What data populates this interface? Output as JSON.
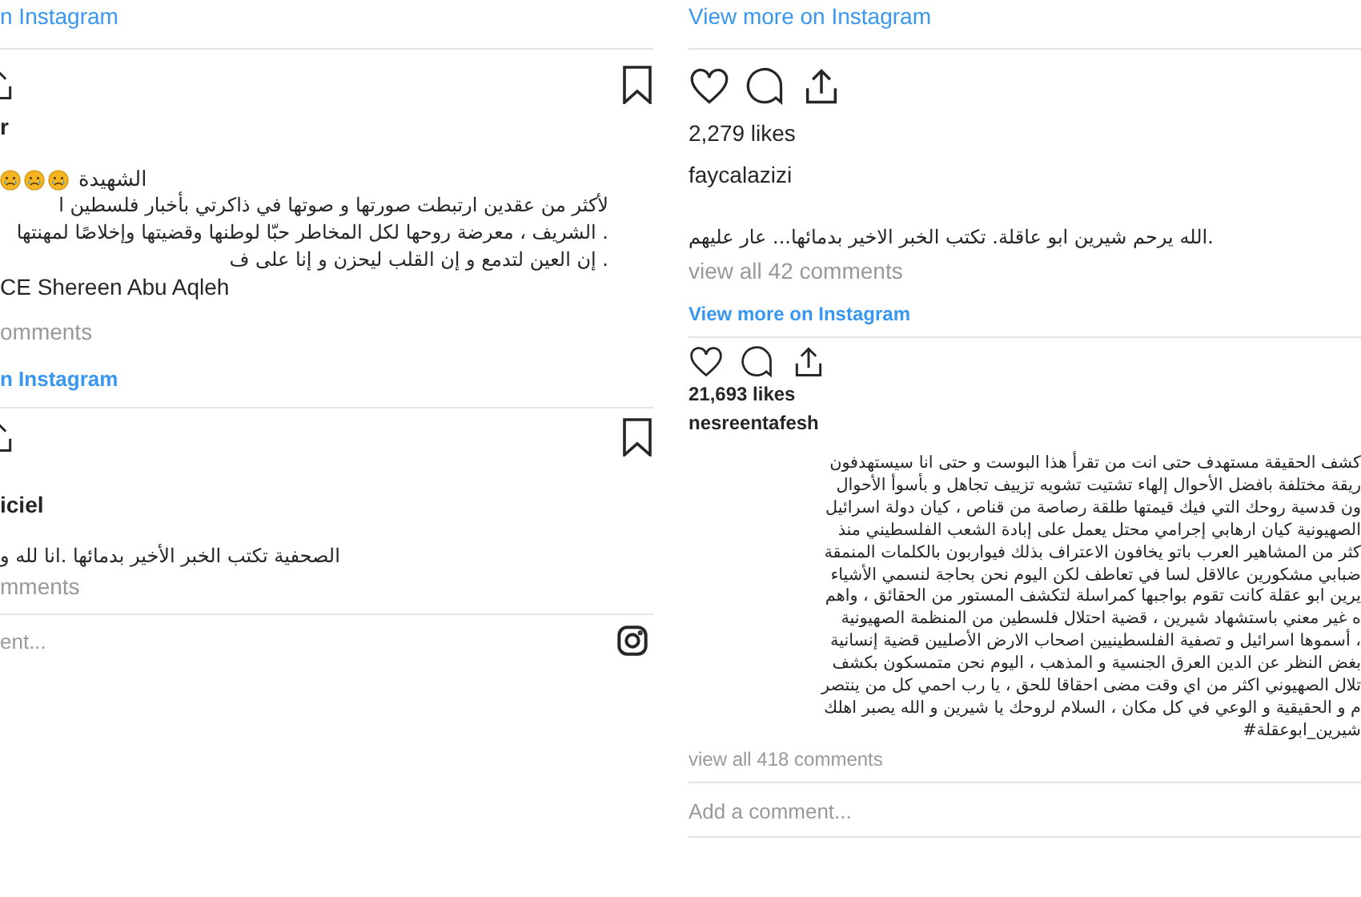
{
  "left_post_1": {
    "view_more_link": "n Instagram",
    "username": "r",
    "caption_title": "الشهيدة",
    "caption_lines": [
      "لأكثر من عقدين ارتبطت صورتها و صوتها في ذاكرتي بأخبار فلسطين ا",
      ". الشريف ، معرضة روحها لكل المخاطر حبّا لوطنها وقضيتها وإخلاصًا لمهنتها",
      ". إن العين لتدمع و إن القلب ليحزن و إنا على ف"
    ],
    "caption_end": "CE Shereen Abu Aqleh",
    "comments_link": "omments",
    "view_more_link_2": "n Instagram"
  },
  "left_post_2": {
    "username": "iciel",
    "caption": "الصحفية تكتب الخبر الأخير بدمائها .انا لله و",
    "comments_link": "mments",
    "comment_placeholder": "ent..."
  },
  "right_post_1": {
    "view_more_link": "View more on Instagram",
    "likes": "2,279 likes",
    "username": "faycalazizi",
    "caption": ".الله يرحم شيرين ابو عاقلة. تكتب الخبر الاخير بدمائها... عار عليهم",
    "comments_link": "view all 42 comments",
    "view_more_link_2": "View more on Instagram"
  },
  "right_post_2": {
    "likes": "21,693 likes",
    "username": "nesreentafesh",
    "caption_lines": [
      "كشف الحقيقة مستهدف حتى انت من تقرأ هذا البوست و حتى انا سيستهدفون",
      "ريقة مختلفة بافضل الأحوال إلهاء تشتيت تشويه تزييف تجاهل و بأسوأ الأحوال",
      "ون قدسية روحك التي فيك قيمتها طلقة رصاصة من قناص ، كيان دولة اسرائيل",
      "الصهيونية كيان ارهابي إجرامي محتل يعمل على إبادة الشعب الفلسطيني منذ",
      "كثر من المشاهير العرب باتو يخافون الاعتراف بذلك فيواربون بالكلمات المنمقة",
      "ضبابي مشكورين عالاقل لسا في تعاطف لكن اليوم نحن بحاجة لنسمي الأشياء",
      "يرين ابو عقلة كانت تقوم بواجبها كمراسلة لتكشف المستور من الحقائق ، واهم",
      "ه غير معني باستشهاد شيرين ، قضية احتلال فلسطين من المنظمة الصهيونية",
      "، أسموها اسرائيل و تصفية الفلسطينيين اصحاب الارض الأصليين قضية إنسانية",
      "بغض النظر عن الدين العرق الجنسية و المذهب ، اليوم نحن متمسكون بكشف",
      "تلال الصهيوني اكثر من اي وقت مضى احقاقا للحق ، يا رب احمي كل من ينتصر",
      "م و الحقيقية و الوعي في كل مكان ، السلام لروحك يا شيرين و الله يصبر اهلك",
      "شيرين_ابوعقلة#"
    ],
    "comments_link": "view all 418 comments",
    "comment_placeholder": "Add a comment..."
  }
}
